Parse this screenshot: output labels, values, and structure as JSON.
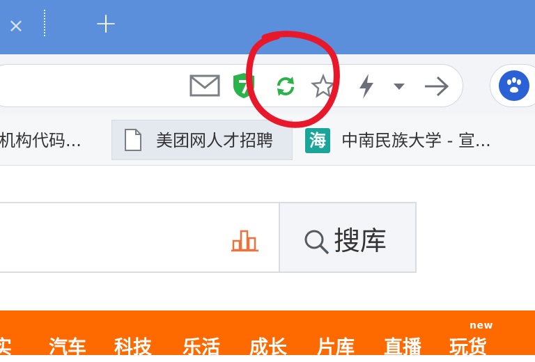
{
  "tab_strip": {
    "close_glyph": "×",
    "new_tab_glyph": "+"
  },
  "toolbar": {
    "icons": [
      "mail-icon",
      "shield-icon",
      "refresh-icon",
      "star-icon",
      "bolt-icon",
      "chevron-down-icon",
      "arrow-right-icon",
      "baidu-paw-icon"
    ],
    "colors": {
      "shield": "#2bb34b",
      "refresh": "#2bb34b",
      "baidu": "#2a62d6"
    }
  },
  "bookmarks": {
    "items": [
      {
        "label": "机构代码..."
      },
      {
        "label": "美团网人才招聘"
      },
      {
        "icon_text": "海",
        "label": "中南民族大学 - 宣..."
      }
    ]
  },
  "page": {
    "search_button_label": "搜库",
    "nav": {
      "items": [
        "实",
        "汽车",
        "科技",
        "乐活",
        "成长",
        "片库",
        "直播",
        "玩货"
      ],
      "badge": "new"
    }
  },
  "colors": {
    "tab_strip": "#5b8fdc",
    "nav_bar": "#ff6a00",
    "annotation": "#e8182a"
  }
}
